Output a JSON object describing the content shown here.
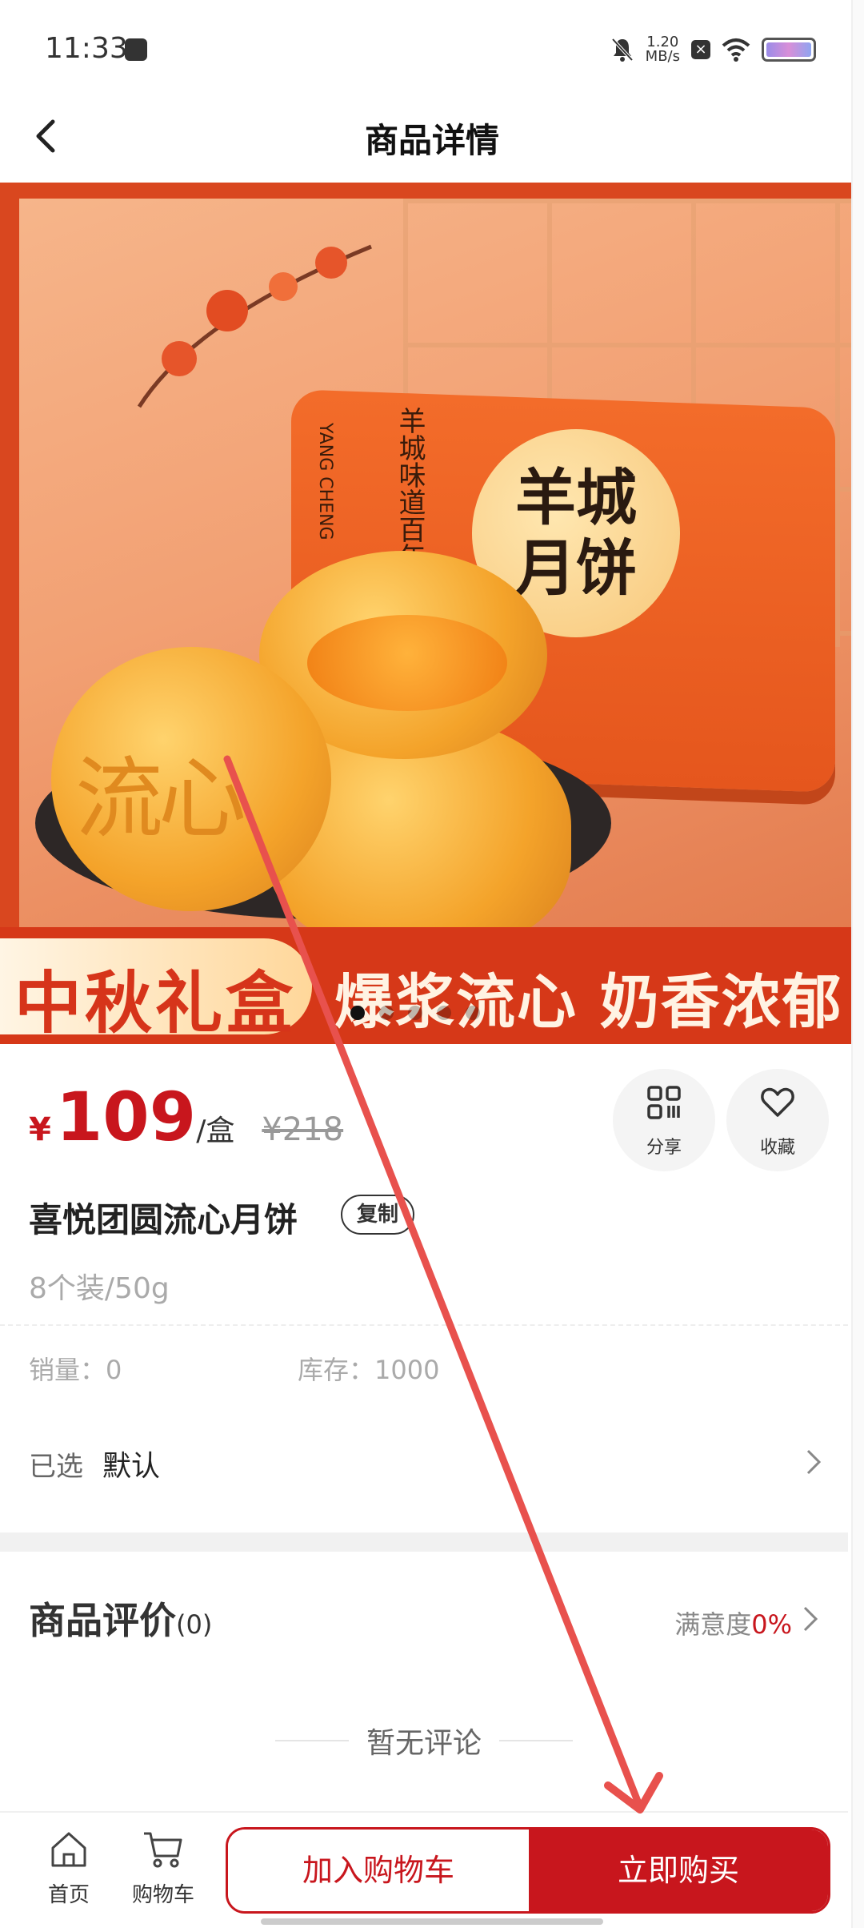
{
  "status_bar": {
    "time": "11:33",
    "net_speed_value": "1.20",
    "net_speed_unit": "MB/s"
  },
  "header": {
    "title": "商品详情"
  },
  "banner": {
    "box_brand": "羊城月饼",
    "box_slogan": "羊城味道百年传承",
    "box_pinyin": "YANG CHENG",
    "mooncake_stamp": "流心",
    "strip_left_text": "中秋礼盒",
    "strip_right_text": "爆浆流心 奶香浓郁",
    "dot_count": 5,
    "active_dot": 0
  },
  "product": {
    "currency": "¥",
    "price": "109",
    "unit": "/盒",
    "original_price": "¥218",
    "name": "喜悦团圆流心月饼",
    "copy_label": "复制",
    "spec": "8个装/50g",
    "sales": "销量：0",
    "stock": "库存：1000",
    "selected_label": "已选",
    "selected_value": "默认"
  },
  "actions": {
    "share_label": "分享",
    "favorite_label": "收藏"
  },
  "reviews": {
    "title": "商品评价",
    "count": "(0)",
    "satisfaction_label": "满意度",
    "satisfaction_value": "0%",
    "empty_text": "暂无评论"
  },
  "bottom_nav": {
    "home_label": "首页",
    "cart_label": "购物车",
    "add_to_cart_label": "加入购物车",
    "buy_now_label": "立即购买"
  },
  "colors": {
    "accent": "#c8161d",
    "annotation_arrow": "#e8514d"
  }
}
